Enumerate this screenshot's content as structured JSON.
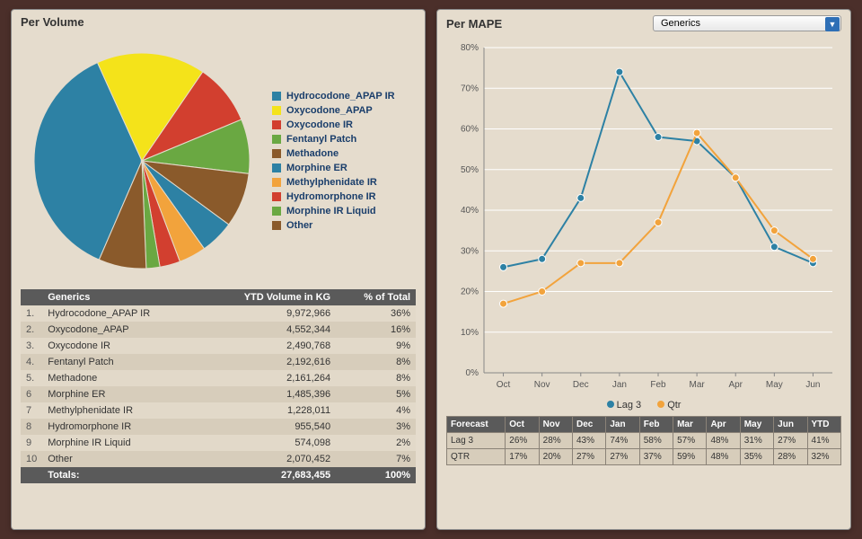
{
  "panels": {
    "volume": {
      "title": "Per Volume"
    },
    "mape": {
      "title": "Per MAPE",
      "dropdown_value": "Generics"
    }
  },
  "colors": {
    "series": {
      "Hydrocodone_APAP IR": "#2d81a4",
      "Oxycodone_APAP": "#f4e31a",
      "Oxycodone IR": "#d23f2f",
      "Fentanyl Patch": "#6aa842",
      "Methadone": "#8a5a2b",
      "Morphine ER": "#2d81a4",
      "Methylphenidate IR": "#f2a33c",
      "Hydromorphone IR": "#d23f2f",
      "Morphine IR Liquid": "#6aa842",
      "Other": "#8a5a2b"
    },
    "lag3": "#2d81a4",
    "qtr": "#f2a33c"
  },
  "chart_data": [
    {
      "id": "pie",
      "type": "pie",
      "title": "Per Volume",
      "categories": [
        "Hydrocodone_APAP IR",
        "Oxycodone_APAP",
        "Oxycodone IR",
        "Fentanyl Patch",
        "Methadone",
        "Morphine ER",
        "Methylphenidate IR",
        "Hydromorphone IR",
        "Morphine IR Liquid",
        "Other"
      ],
      "values": [
        36,
        16,
        9,
        8,
        8,
        5,
        4,
        3,
        2,
        7
      ],
      "legend_position": "right"
    },
    {
      "id": "mape_line",
      "type": "line",
      "title": "Per MAPE",
      "x": [
        "Oct",
        "Nov",
        "Dec",
        "Jan",
        "Feb",
        "Mar",
        "Apr",
        "May",
        "Jun"
      ],
      "series": [
        {
          "name": "Lag 3",
          "values": [
            26,
            28,
            43,
            74,
            58,
            57,
            48,
            31,
            27
          ]
        },
        {
          "name": "Qtr",
          "values": [
            17,
            20,
            27,
            27,
            37,
            59,
            48,
            35,
            28
          ]
        }
      ],
      "ylabel": "",
      "xlabel": "",
      "ylim": [
        0,
        80
      ],
      "y_ticks": [
        0,
        10,
        20,
        30,
        40,
        50,
        60,
        70,
        80
      ],
      "y_tick_format": "%",
      "grid": true,
      "legend_position": "bottom"
    }
  ],
  "volume_table": {
    "headers": [
      "Generics",
      "YTD Volume in KG",
      "% of Total"
    ],
    "rows": [
      {
        "idx": "1.",
        "name": "Hydrocodone_APAP IR",
        "ytd": "9,972,966",
        "pct": "36%"
      },
      {
        "idx": "2.",
        "name": "Oxycodone_APAP",
        "ytd": "4,552,344",
        "pct": "16%"
      },
      {
        "idx": "3.",
        "name": "Oxycodone IR",
        "ytd": "2,490,768",
        "pct": "9%"
      },
      {
        "idx": "4.",
        "name": "Fentanyl Patch",
        "ytd": "2,192,616",
        "pct": "8%"
      },
      {
        "idx": "5.",
        "name": "Methadone",
        "ytd": "2,161,264",
        "pct": "8%"
      },
      {
        "idx": "6",
        "name": "Morphine ER",
        "ytd": "1,485,396",
        "pct": "5%"
      },
      {
        "idx": "7",
        "name": "Methylphenidate IR",
        "ytd": "1,228,011",
        "pct": "4%"
      },
      {
        "idx": "8",
        "name": "Hydromorphone IR",
        "ytd": "955,540",
        "pct": "3%"
      },
      {
        "idx": "9",
        "name": "Morphine IR Liquid",
        "ytd": "574,098",
        "pct": "2%"
      },
      {
        "idx": "10",
        "name": "Other",
        "ytd": "2,070,452",
        "pct": "7%"
      }
    ],
    "totals": {
      "label": "Totals:",
      "ytd": "27,683,455",
      "pct": "100%"
    }
  },
  "forecast_table": {
    "headers": [
      "Forecast",
      "Oct",
      "Nov",
      "Dec",
      "Jan",
      "Feb",
      "Mar",
      "Apr",
      "May",
      "Jun",
      "YTD"
    ],
    "rows": [
      {
        "label": "Lag 3",
        "cells": [
          "26%",
          "28%",
          "43%",
          "74%",
          "58%",
          "57%",
          "48%",
          "31%",
          "27%",
          "41%"
        ]
      },
      {
        "label": "QTR",
        "cells": [
          "17%",
          "20%",
          "27%",
          "27%",
          "37%",
          "59%",
          "48%",
          "35%",
          "28%",
          "32%"
        ]
      }
    ]
  },
  "legend_labels": {
    "lag3": "Lag 3",
    "qtr": "Qtr"
  }
}
